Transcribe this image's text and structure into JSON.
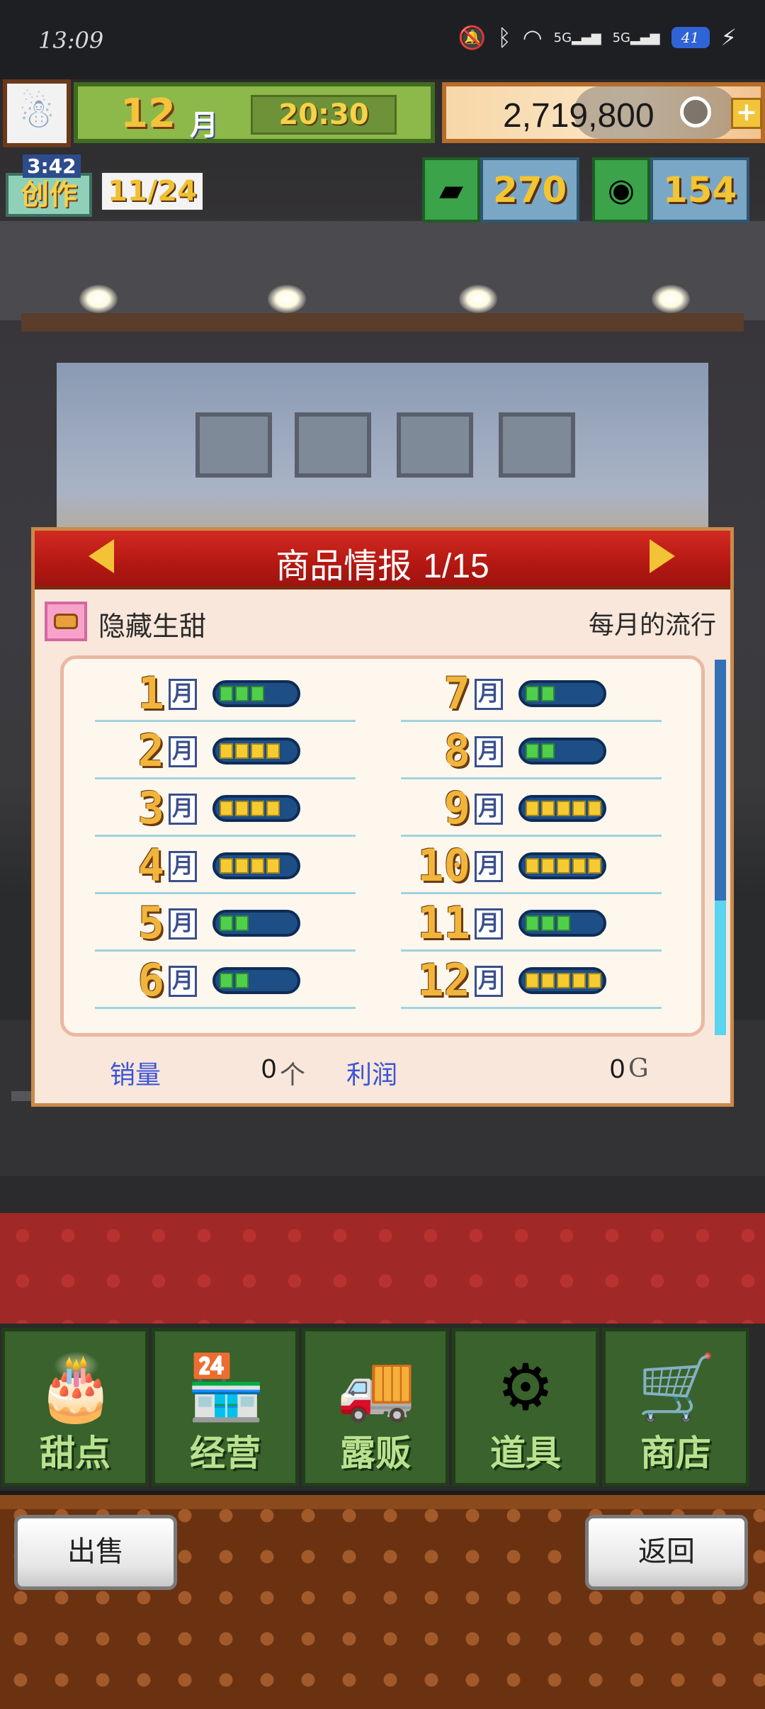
{
  "status_bar": {
    "time": "13:09",
    "icons": [
      "mute-icon",
      "bluetooth-icon",
      "wifi-icon",
      "signal-5g-icon",
      "signal-5g-icon"
    ],
    "signal_label_1": "5G",
    "signal_label_2": "5G",
    "battery": "41"
  },
  "hud": {
    "month_num": "12",
    "month_unit": "月",
    "clock": "20:30",
    "money": "2,719,800",
    "create_timer": "3:42",
    "create_label": "创作",
    "create_count": "11/24",
    "gold_bars": "270",
    "medals": "154"
  },
  "dialog": {
    "title": "商品情报",
    "page": "1/15",
    "item_name": "隐藏生甜",
    "trend_label": "每月的流行",
    "months_left": [
      {
        "num": "1",
        "unit": "月",
        "level": 3,
        "max": 5,
        "color": "green"
      },
      {
        "num": "2",
        "unit": "月",
        "level": 4,
        "max": 5,
        "color": "yellow"
      },
      {
        "num": "3",
        "unit": "月",
        "level": 4,
        "max": 5,
        "color": "yellow"
      },
      {
        "num": "4",
        "unit": "月",
        "level": 4,
        "max": 5,
        "color": "yellow"
      },
      {
        "num": "5",
        "unit": "月",
        "level": 2,
        "max": 5,
        "color": "green"
      },
      {
        "num": "6",
        "unit": "月",
        "level": 2,
        "max": 5,
        "color": "green"
      }
    ],
    "months_right": [
      {
        "num": "7",
        "unit": "月",
        "level": 2,
        "max": 5,
        "color": "green"
      },
      {
        "num": "8",
        "unit": "月",
        "level": 2,
        "max": 5,
        "color": "green"
      },
      {
        "num": "9",
        "unit": "月",
        "level": 5,
        "max": 5,
        "color": "yellow"
      },
      {
        "num": "10",
        "unit": "月",
        "level": 5,
        "max": 5,
        "color": "yellow"
      },
      {
        "num": "11",
        "unit": "月",
        "level": 3,
        "max": 5,
        "color": "green"
      },
      {
        "num": "12",
        "unit": "月",
        "level": 5,
        "max": 5,
        "color": "yellow"
      }
    ],
    "sales_label": "销量",
    "sales_value": "0",
    "sales_unit": "个",
    "profit_label": "利润",
    "profit_value": "0",
    "profit_unit": "G"
  },
  "nav": [
    {
      "label": "甜点",
      "icon": "cake-icon"
    },
    {
      "label": "经营",
      "icon": "shop-building-icon"
    },
    {
      "label": "露贩",
      "icon": "food-truck-icon"
    },
    {
      "label": "道具",
      "icon": "gear-bag-icon"
    },
    {
      "label": "商店",
      "icon": "cart-icon"
    }
  ],
  "actions": {
    "sell": "出售",
    "back": "返回"
  },
  "colors": {
    "header_red": "#b41812",
    "bar_green": "#4fd04b",
    "bar_yellow": "#f6cb31",
    "nav_green": "#39622d",
    "label_blue": "#3c55d6"
  }
}
